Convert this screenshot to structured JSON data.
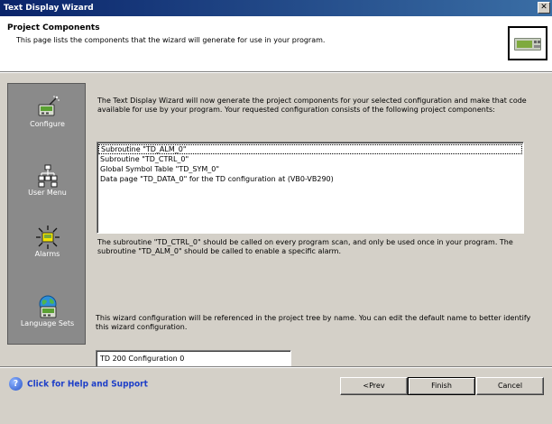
{
  "window": {
    "title": "Text Display Wizard",
    "close_label": "✕"
  },
  "header": {
    "title": "Project Components",
    "subtitle": "This page lists the components that the wizard will generate for use in your program."
  },
  "sidebar": {
    "items": [
      {
        "label": "Configure",
        "icon": "lcd-wand-icon"
      },
      {
        "label": "User Menu",
        "icon": "menu-tree-icon"
      },
      {
        "label": "Alarms",
        "icon": "alarm-starburst-icon"
      },
      {
        "label": "Language Sets",
        "icon": "globe-lcd-icon"
      }
    ]
  },
  "main": {
    "intro": "The Text Display Wizard will now generate the project components for your selected configuration and make that code available for use by your program. Your requested configuration consists of the following project components:",
    "components": [
      "Subroutine \"TD_ALM_0\"",
      "Subroutine \"TD_CTRL_0\"",
      "Global Symbol Table \"TD_SYM_0\"",
      "Data page \"TD_DATA_0\" for the TD configuration at (VB0-VB290)"
    ],
    "note": "The subroutine \"TD_CTRL_0\" should be called on every program scan, and only be used once in your program. The subroutine \"TD_ALM_0\" should be called to enable a specific alarm.",
    "name_note": "This wizard configuration will be referenced in the project tree by name. You can edit the default name to better identify this wizard configuration.",
    "config_name": "TD 200 Configuration 0"
  },
  "footer": {
    "help_label": "Click for Help and Support",
    "prev_label": "<Prev",
    "finish_label": "Finish",
    "cancel_label": "Cancel"
  }
}
